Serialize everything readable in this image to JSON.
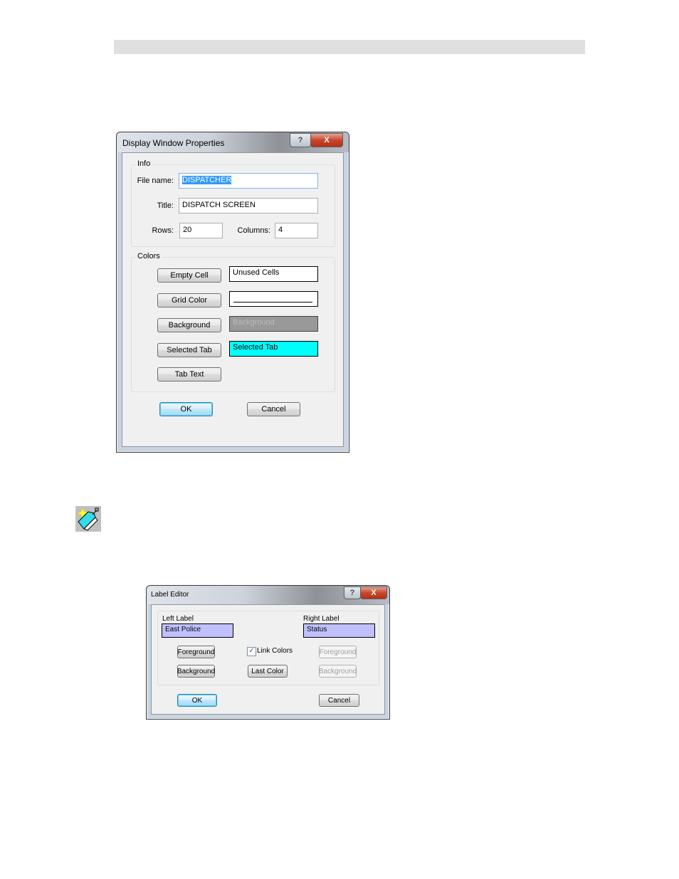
{
  "display_window_properties": {
    "title": "Display Window Properties",
    "help_glyph": "?",
    "close_glyph": "X",
    "info_group": "Info",
    "file_name_label": "File name:",
    "file_name_value": "DISPATCHER",
    "title_label": "Title:",
    "title_value": "DISPATCH SCREEN",
    "rows_label": "Rows:",
    "rows_value": "20",
    "columns_label": "Columns:",
    "columns_value": "4",
    "colors_group": "Colors",
    "color_rows": [
      {
        "button": "Empty Cell",
        "swatch_text": "Unused Cells",
        "swatch_color": "#ffffff"
      },
      {
        "button": "Grid Color",
        "swatch_text": "",
        "swatch_color": "#ffffff"
      },
      {
        "button": "Background",
        "swatch_text": "Background",
        "swatch_color": "#999999"
      },
      {
        "button": "Selected Tab",
        "swatch_text": "Selected Tab",
        "swatch_color": "#00ffff"
      },
      {
        "button": "Tab Text"
      }
    ],
    "ok": "OK",
    "cancel": "Cancel"
  },
  "label_editor": {
    "title": "Label Editor",
    "help_glyph": "?",
    "close_glyph": "X",
    "left_label_caption": "Left Label",
    "left_label_value": "East Police",
    "right_label_caption": "Right Label",
    "right_label_value": "Status",
    "label_field_color": "#c0c0ff",
    "left_foreground": "Foreground",
    "left_background": "Background",
    "link_colors": "Link Colors",
    "link_colors_checked": true,
    "last_color": "Last Color",
    "right_foreground": "Foreground",
    "right_background": "Background",
    "ok": "OK",
    "cancel": "Cancel"
  }
}
